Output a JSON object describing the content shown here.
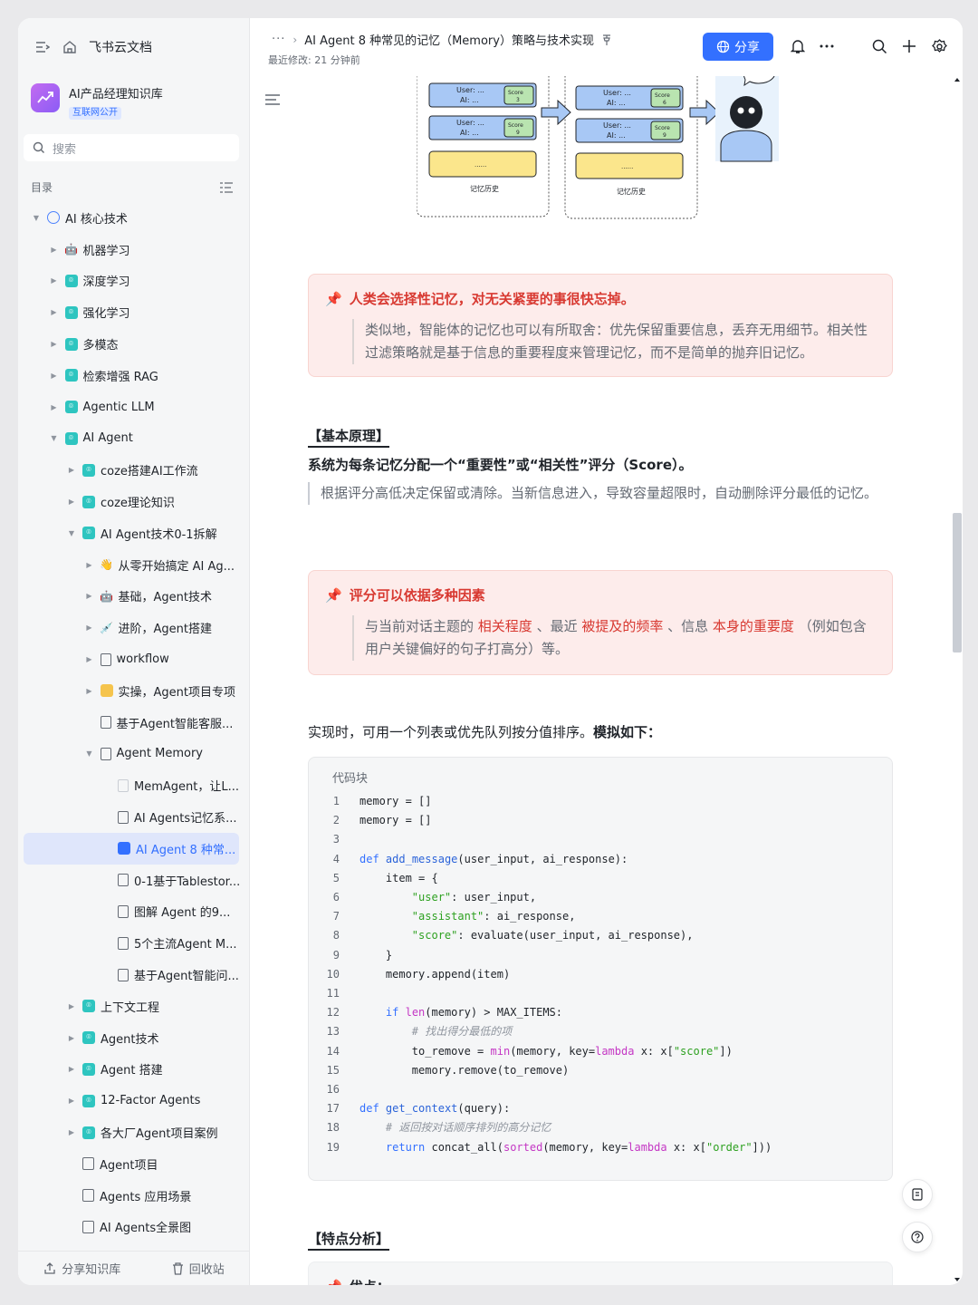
{
  "sidebar": {
    "app_name": "飞书云文档",
    "kb_name": "AI产品经理知识库",
    "kb_tag": "互联网公开",
    "search_placeholder": "搜索",
    "toc_label": "目录",
    "items": [
      {
        "label": "AI 核心技术",
        "level": 0,
        "caret": "down",
        "icon": "globe"
      },
      {
        "label": "机器学习",
        "level": 1,
        "caret": "right",
        "icon": "robot"
      },
      {
        "label": "深度学习",
        "level": 1,
        "caret": "right",
        "icon": "teal"
      },
      {
        "label": "强化学习",
        "level": 1,
        "caret": "right",
        "icon": "teal"
      },
      {
        "label": "多模态",
        "level": 1,
        "caret": "right",
        "icon": "teal"
      },
      {
        "label": "检索增强 RAG",
        "level": 1,
        "caret": "right",
        "icon": "teal"
      },
      {
        "label": "Agentic LLM",
        "level": 1,
        "caret": "right",
        "icon": "teal"
      },
      {
        "label": "AI Agent",
        "level": 1,
        "caret": "down",
        "icon": "teal"
      },
      {
        "label": "coze搭建AI工作流",
        "level": 2,
        "caret": "right",
        "icon": "teal"
      },
      {
        "label": "coze理论知识",
        "level": 2,
        "caret": "right",
        "icon": "teal"
      },
      {
        "label": "AI Agent技术0-1拆解",
        "level": 2,
        "caret": "down",
        "icon": "teal"
      },
      {
        "label": "从零开始搞定 AI Ag...",
        "level": 3,
        "caret": "right",
        "icon": "hand"
      },
      {
        "label": "基础，Agent技术",
        "level": 3,
        "caret": "right",
        "icon": "robot"
      },
      {
        "label": "进阶，Agent搭建",
        "level": 3,
        "caret": "right",
        "icon": "syringe"
      },
      {
        "label": "workflow",
        "level": 3,
        "caret": "right",
        "icon": "doc"
      },
      {
        "label": "实操，Agent项目专项",
        "level": 3,
        "caret": "right",
        "icon": "folder"
      },
      {
        "label": "基于Agent智能客服...",
        "level": 3,
        "caret": "",
        "icon": "doc"
      },
      {
        "label": "Agent Memory",
        "level": 3,
        "caret": "down",
        "icon": "doc"
      },
      {
        "label": "MemAgent，让L...",
        "level": 4,
        "caret": "",
        "icon": "page"
      },
      {
        "label": "AI Agents记忆系...",
        "level": 4,
        "caret": "",
        "icon": "doc"
      },
      {
        "label": "AI Agent 8 种常...",
        "level": 4,
        "caret": "",
        "icon": "blue",
        "active": true
      },
      {
        "label": "0-1基于Tablestor...",
        "level": 4,
        "caret": "",
        "icon": "doc"
      },
      {
        "label": "图解 Agent 的9...",
        "level": 4,
        "caret": "",
        "icon": "doc"
      },
      {
        "label": "5个主流Agent M...",
        "level": 4,
        "caret": "",
        "icon": "doc"
      },
      {
        "label": "基于Agent智能问...",
        "level": 4,
        "caret": "",
        "icon": "doc"
      },
      {
        "label": "上下文工程",
        "level": 2,
        "caret": "right",
        "icon": "teal"
      },
      {
        "label": "Agent技术",
        "level": 2,
        "caret": "right",
        "icon": "teal"
      },
      {
        "label": "Agent 搭建",
        "level": 2,
        "caret": "right",
        "icon": "teal"
      },
      {
        "label": "12-Factor Agents",
        "level": 2,
        "caret": "right",
        "icon": "teal"
      },
      {
        "label": "各大厂Agent项目案例",
        "level": 2,
        "caret": "right",
        "icon": "teal"
      },
      {
        "label": "Agent项目",
        "level": 2,
        "caret": "",
        "icon": "sheet"
      },
      {
        "label": "Agents 应用场景",
        "level": 2,
        "caret": "",
        "icon": "sheet"
      },
      {
        "label": "AI Agents全景图",
        "level": 2,
        "caret": "",
        "icon": "sheet"
      }
    ],
    "footer_share": "分享知识库",
    "footer_trash": "回收站"
  },
  "topbar": {
    "breadcrumb_more": "···",
    "doc_title": "AI Agent 8 种常见的记忆（Memory）策略与技术实现",
    "modified": "最近修改: 21 分钟前",
    "share_label": "分享"
  },
  "diagram": {
    "user_line": "User: ...",
    "ai_line": "AI: ...",
    "score_label": "Score",
    "scores_left": [
      "3",
      "9"
    ],
    "scores_right": [
      "6",
      "9"
    ],
    "ellipsis": "......",
    "caption": "记忆历史"
  },
  "callout1": {
    "title": "人类会选择性记忆，对无关紧要的事很快忘掉。",
    "body": "类似地，智能体的记忆也可以有所取舍：优先保留重要信息，丢弃无用细节。相关性过滤策略就是基于信息的重要程度来管理记忆，而不是简单的抛弃旧记忆。"
  },
  "section1": {
    "heading": "【基本原理】",
    "strong": "系统为每条记忆分配一个“重要性”或“相关性”评分（Score）。",
    "quote": "根据评分高低决定保留或清除。当新信息进入，导致容量超限时，自动删除评分最低的记忆。"
  },
  "callout2": {
    "title": "评分可以依据多种因素",
    "b1": "与当前对话主题的 ",
    "h1": "相关程度",
    "b2": " 、最近 ",
    "h2": "被提及的频率",
    "b3": " 、信息 ",
    "h3": "本身的重要度",
    "b4": " （例如包含用户关键偏好的句子打高分）等。"
  },
  "para": {
    "normal": "实现时，可用一个列表或优先队列按分值排序。",
    "bold": "模拟如下："
  },
  "code": {
    "label": "代码块"
  },
  "section2": {
    "heading": "【特点分析】",
    "pros": "优点："
  }
}
